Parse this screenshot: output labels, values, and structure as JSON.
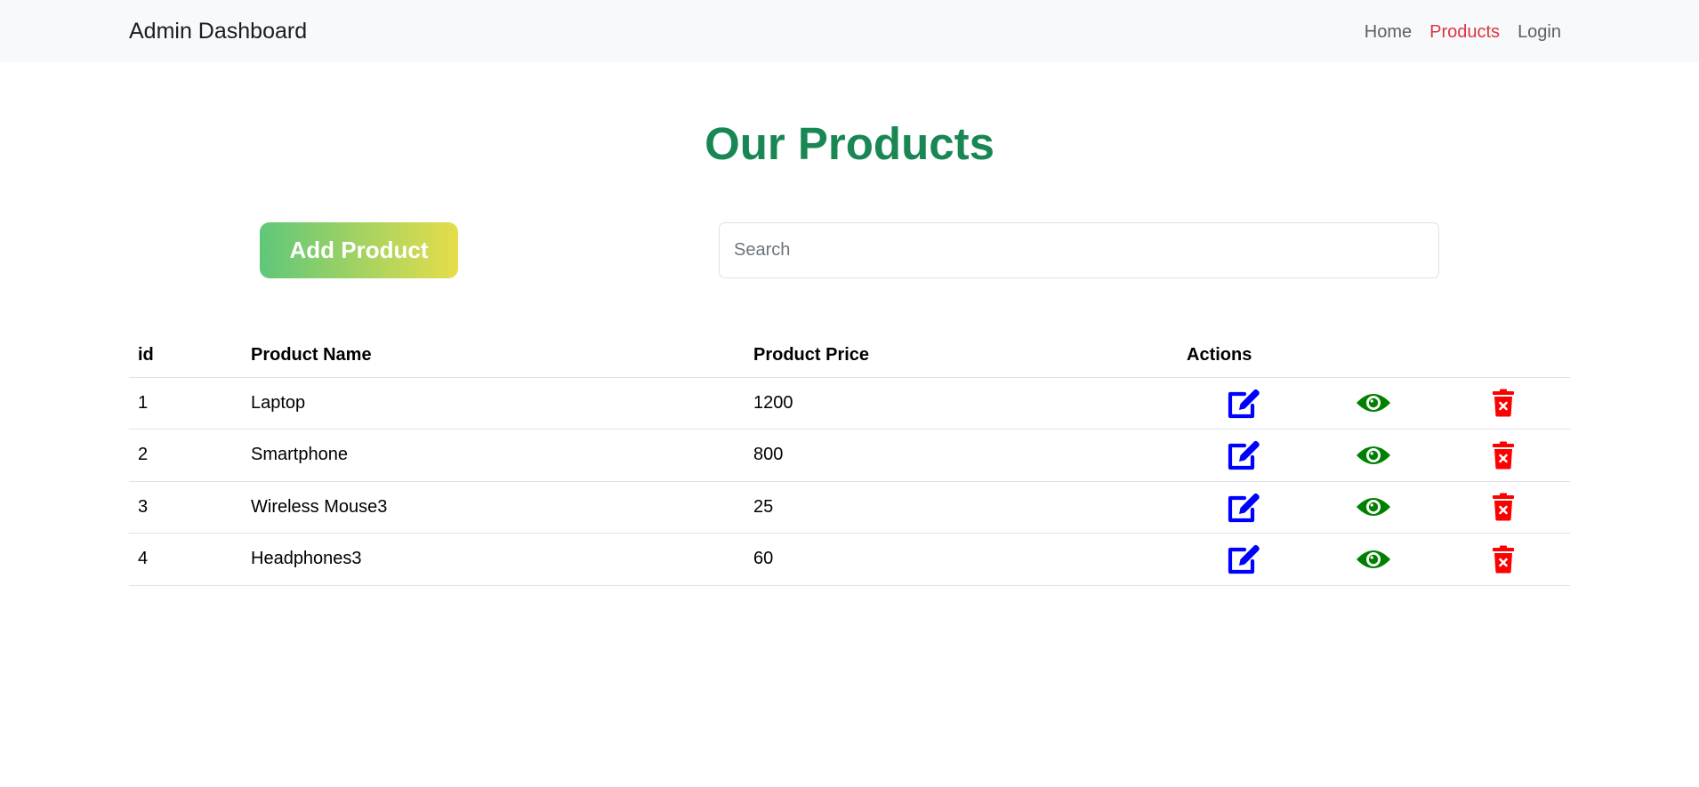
{
  "navbar": {
    "brand": "Admin Dashboard",
    "links": [
      {
        "label": "Home",
        "active": false
      },
      {
        "label": "Products",
        "active": true
      },
      {
        "label": "Login",
        "active": false
      }
    ]
  },
  "page": {
    "title": "Our Products"
  },
  "toolbar": {
    "add_label": "Add Product",
    "search_placeholder": "Search",
    "search_value": ""
  },
  "table": {
    "headers": {
      "id": "id",
      "name": "Product Name",
      "price": "Product Price",
      "actions": "Actions"
    },
    "rows": [
      {
        "id": "1",
        "name": "Laptop",
        "price": "1200"
      },
      {
        "id": "2",
        "name": "Smartphone",
        "price": "800"
      },
      {
        "id": "3",
        "name": "Wireless Mouse3",
        "price": "25"
      },
      {
        "id": "4",
        "name": "Headphones3",
        "price": "60"
      }
    ],
    "action_icons": {
      "edit": "edit-icon",
      "view": "eye-icon",
      "delete": "trash-icon"
    }
  },
  "colors": {
    "title": "#198754",
    "active_link": "#dc3545",
    "edit_icon": "#0000ff",
    "view_icon": "#008000",
    "delete_icon": "#ff0000",
    "add_gradient_start": "#5fc77a",
    "add_gradient_end": "#e6dd4a"
  }
}
